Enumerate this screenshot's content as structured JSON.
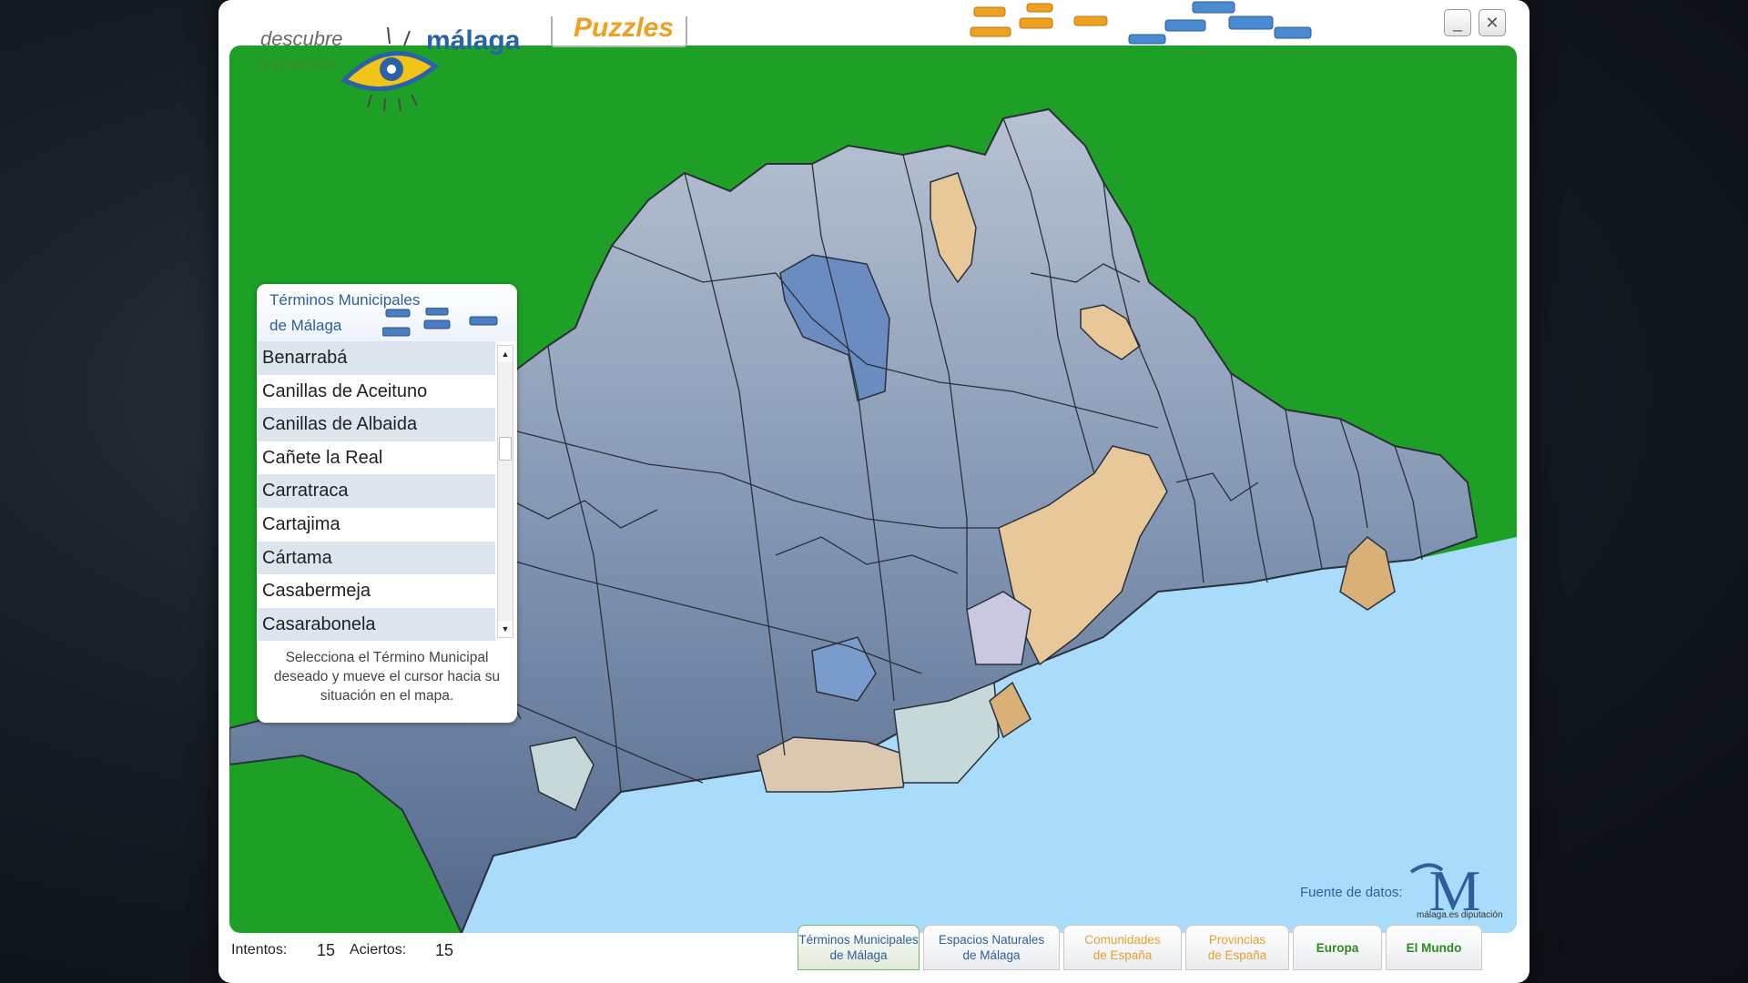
{
  "app": {
    "logo_descubre": "descubre",
    "logo_tu_provincia": "tu provincia",
    "logo_malaga": "málaga",
    "title": "Puzzles",
    "minimize_icon": "minimize-icon",
    "close_icon": "close-icon"
  },
  "panel": {
    "title_line1": "Términos Municipales",
    "title_line2": "de Málaga",
    "items": [
      "Benarrabá",
      "Canillas de Aceituno",
      "Canillas de Albaida",
      "Cañete la Real",
      "Carratraca",
      "Cartajima",
      "Cártama",
      "Casabermeja",
      "Casarabonela"
    ],
    "help_text": "Selecciona el Término Municipal deseado y mueve el cursor hacia su situación en el mapa."
  },
  "status": {
    "intentos_label": "Intentos:",
    "intentos_value": "15",
    "aciertos_label": "Aciertos:",
    "aciertos_value": "15"
  },
  "source": {
    "label": "Fuente de datos:",
    "logo_letter": "M",
    "logo_caption": "málaga.es diputación"
  },
  "tabs": [
    {
      "label": "Términos Municipales\nde Málaga",
      "color": "#2d5f9e",
      "active": true
    },
    {
      "label": "Espacios Naturales\nde Málaga",
      "color": "#2d5f9e",
      "active": false
    },
    {
      "label": "Comunidades\nde España",
      "color": "#e8a030",
      "active": false
    },
    {
      "label": "Provincias\nde España",
      "color": "#e8a030",
      "active": false
    },
    {
      "label": "Europa",
      "color": "#2e8a1e",
      "active": false
    },
    {
      "label": "El Mundo",
      "color": "#2e8a1e",
      "active": false
    }
  ],
  "colors": {
    "land_green": "#1da025",
    "sea_blue": "#a8dcfa",
    "placed_piece": "#6f86a8",
    "highlight_piece": "#e8c898"
  }
}
